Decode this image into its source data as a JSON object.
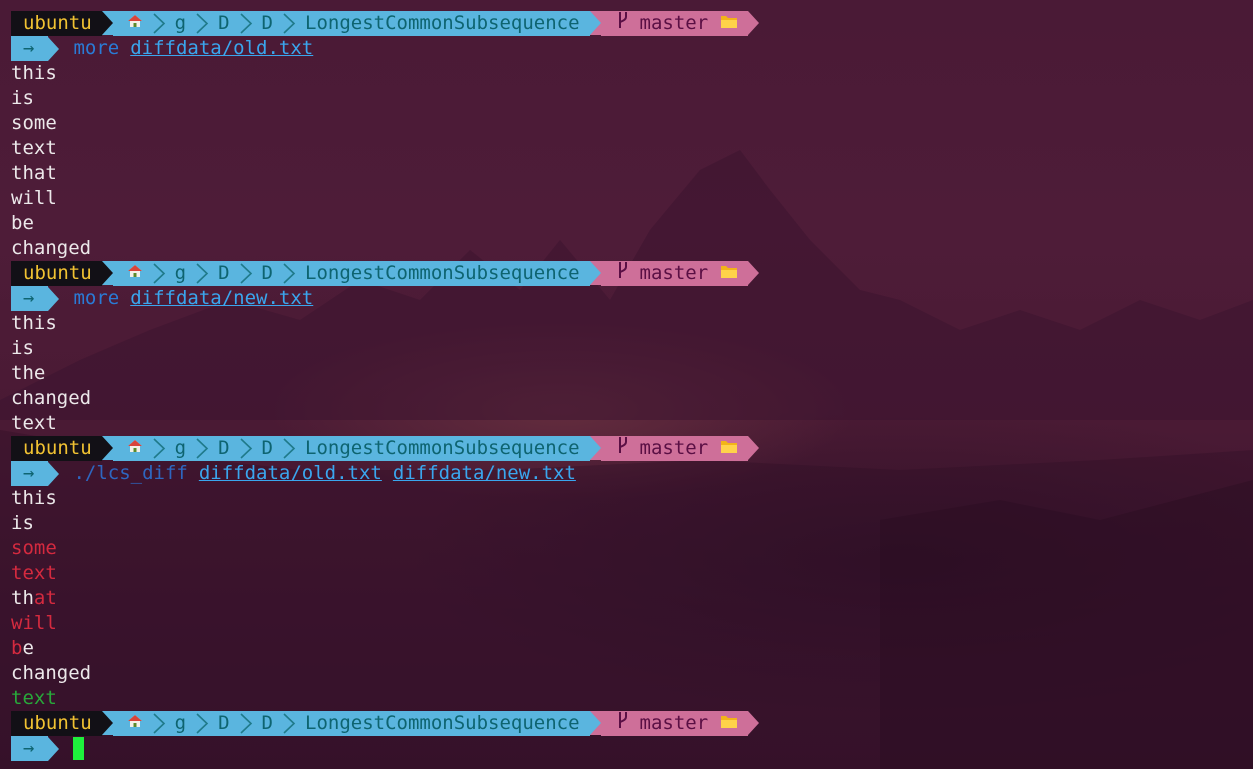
{
  "prompt": {
    "user": "ubuntu",
    "home_icon": "house-icon",
    "path": [
      "g",
      "D",
      "D",
      "LongestCommonSubsequence"
    ],
    "branch_icon": "git-branch-icon",
    "branch": "master",
    "folder_icon": "folder-icon",
    "arrow": "→"
  },
  "blocks": [
    {
      "command": "more",
      "args": [
        "diffdata/old.txt"
      ],
      "output": [
        {
          "segments": [
            {
              "t": "this",
              "k": "out"
            }
          ]
        },
        {
          "segments": [
            {
              "t": "is",
              "k": "out"
            }
          ]
        },
        {
          "segments": [
            {
              "t": "some",
              "k": "out"
            }
          ]
        },
        {
          "segments": [
            {
              "t": "text",
              "k": "out"
            }
          ]
        },
        {
          "segments": [
            {
              "t": "that",
              "k": "out"
            }
          ]
        },
        {
          "segments": [
            {
              "t": "will",
              "k": "out"
            }
          ]
        },
        {
          "segments": [
            {
              "t": "be",
              "k": "out"
            }
          ]
        },
        {
          "segments": [
            {
              "t": "changed",
              "k": "out"
            }
          ]
        }
      ]
    },
    {
      "command": "more",
      "args": [
        "diffdata/new.txt"
      ],
      "output": [
        {
          "segments": [
            {
              "t": "this",
              "k": "out"
            }
          ]
        },
        {
          "segments": [
            {
              "t": "is",
              "k": "out"
            }
          ]
        },
        {
          "segments": [
            {
              "t": "the",
              "k": "out"
            }
          ]
        },
        {
          "segments": [
            {
              "t": "changed",
              "k": "out"
            }
          ]
        },
        {
          "segments": [
            {
              "t": "text",
              "k": "out"
            }
          ]
        }
      ]
    },
    {
      "command": "./lcs_diff",
      "args": [
        "diffdata/old.txt",
        "diffdata/new.txt"
      ],
      "output": [
        {
          "segments": [
            {
              "t": "this",
              "k": "out"
            }
          ]
        },
        {
          "segments": [
            {
              "t": "is",
              "k": "out"
            }
          ]
        },
        {
          "segments": [
            {
              "t": "some",
              "k": "del"
            }
          ]
        },
        {
          "segments": [
            {
              "t": "text",
              "k": "del"
            }
          ]
        },
        {
          "segments": [
            {
              "t": "th",
              "k": "out"
            },
            {
              "t": "at",
              "k": "del"
            }
          ]
        },
        {
          "segments": [
            {
              "t": "will",
              "k": "del"
            }
          ]
        },
        {
          "segments": [
            {
              "t": "b",
              "k": "del"
            },
            {
              "t": "e",
              "k": "out"
            }
          ]
        },
        {
          "segments": [
            {
              "t": "changed",
              "k": "out"
            }
          ]
        },
        {
          "segments": [
            {
              "t": "text",
              "k": "add"
            }
          ]
        }
      ]
    }
  ],
  "colors": {
    "background": "#4a1a36",
    "user_segment": "#121016",
    "user_text": "#f1c232",
    "path_segment": "#5ab5df",
    "path_text": "#0e6470",
    "git_segment": "#ce6f99",
    "git_text": "#5a0f44",
    "deleted": "#d42a3f",
    "added": "#28a83a",
    "cursor": "#1ef03c"
  }
}
